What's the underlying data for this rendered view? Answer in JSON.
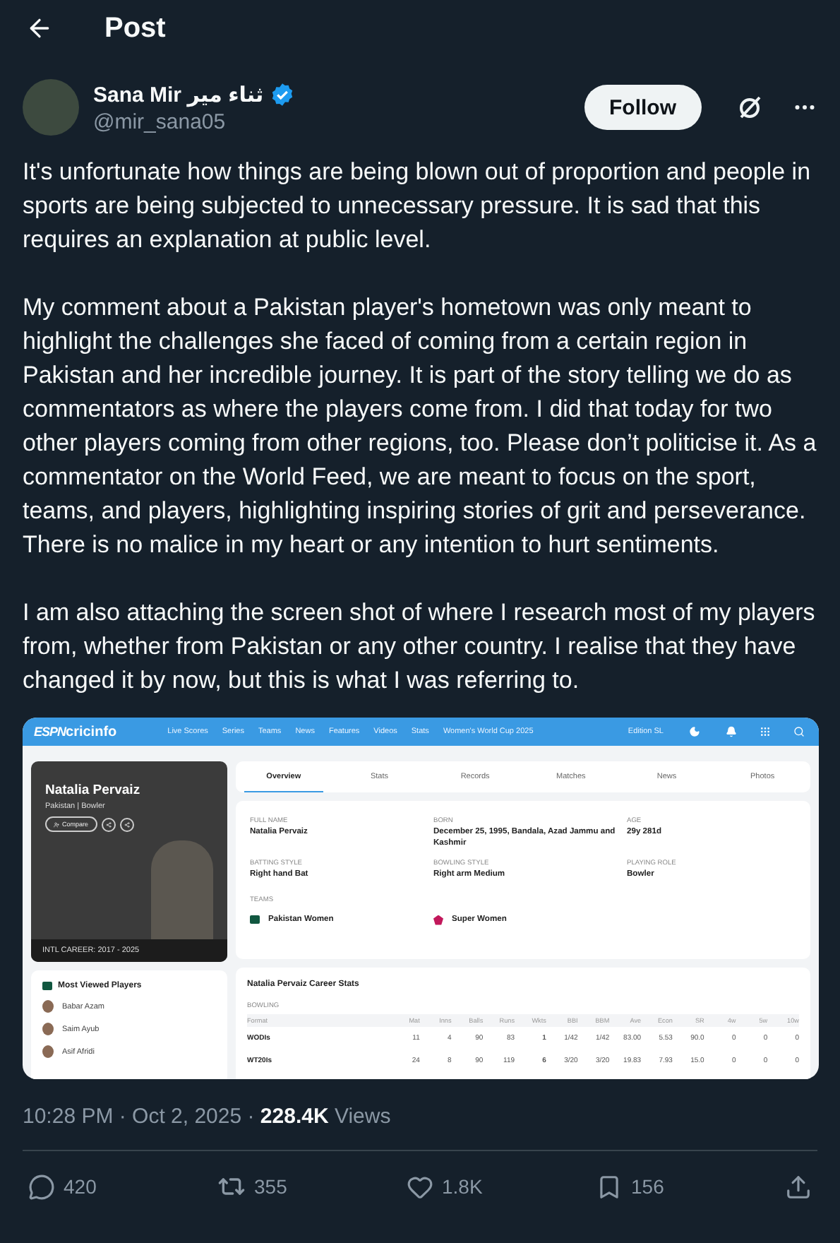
{
  "header": {
    "title": "Post"
  },
  "author": {
    "name": "Sana Mir ثناء میر",
    "handle": "@mir_sana05",
    "verified": true,
    "follow_label": "Follow"
  },
  "paragraphs": [
    "It's unfortunate how things are being blown out of proportion and people in sports are being subjected to unnecessary pressure. It is sad that this requires an explanation at public level.",
    "My comment about a Pakistan player's hometown was only meant to highlight the challenges she faced of coming from a certain region in Pakistan and her incredible journey. It is part of the story telling we do as commentators as where the players come from. I did that today for two other players coming from other regions, too. Please don’t politicise it. As a commentator on the World Feed, we are meant to focus on the sport, teams, and players, highlighting inspiring stories of grit and perseverance. There is no malice in my heart or any intention to hurt sentiments.",
    "I am also attaching the screen shot of where I research most of my players from, whether from Pakistan or any other country. I realise that they have changed it by now, but this is what I was referring to."
  ],
  "embed": {
    "nav": {
      "brand": "ESPN",
      "site": "cricinfo",
      "links": [
        "Live Scores",
        "Series",
        "Teams",
        "News",
        "Features",
        "Videos",
        "Stats",
        "Women's World Cup 2025"
      ],
      "edition": "Edition SL"
    },
    "profile": {
      "name": "Natalia Pervaiz",
      "subtitle": "Pakistan | Bowler",
      "compare_label": "Compare",
      "career": "INTL CAREER: 2017 - 2025"
    },
    "most_viewed": {
      "title": "Most Viewed Players",
      "players": [
        "Babar Azam",
        "Saim Ayub",
        "Asif Afridi"
      ]
    },
    "tabs": [
      {
        "label": "Overview",
        "selected": true
      },
      {
        "label": "Stats",
        "selected": false
      },
      {
        "label": "Records",
        "selected": false
      },
      {
        "label": "Matches",
        "selected": false
      },
      {
        "label": "News",
        "selected": false
      },
      {
        "label": "Photos",
        "selected": false
      }
    ],
    "fields": [
      {
        "label": "FULL NAME",
        "value": "Natalia Pervaiz"
      },
      {
        "label": "BORN",
        "value": "December 25, 1995, Bandala, Azad Jammu and Kashmir"
      },
      {
        "label": "AGE",
        "value": "29y 281d"
      },
      {
        "label": "BATTING STYLE",
        "value": "Right hand Bat"
      },
      {
        "label": "BOWLING STYLE",
        "value": "Right arm Medium"
      },
      {
        "label": "PLAYING ROLE",
        "value": "Bowler"
      }
    ],
    "teams": {
      "label": "TEAMS",
      "items": [
        {
          "kind": "flag",
          "name": "Pakistan Women"
        },
        {
          "kind": "club",
          "name": "Super Women"
        }
      ]
    },
    "stats": {
      "title": "Natalia Pervaiz Career Stats",
      "section": "BOWLING",
      "columns": [
        "Format",
        "Mat",
        "Inns",
        "Balls",
        "Runs",
        "Wkts",
        "BBI",
        "BBM",
        "Ave",
        "Econ",
        "SR",
        "4w",
        "5w",
        "10w"
      ],
      "rows": [
        [
          "WODIs",
          "11",
          "4",
          "90",
          "83",
          "1",
          "1/42",
          "1/42",
          "83.00",
          "5.53",
          "90.0",
          "0",
          "0",
          "0"
        ],
        [
          "WT20Is",
          "24",
          "8",
          "90",
          "119",
          "6",
          "3/20",
          "3/20",
          "19.83",
          "7.93",
          "15.0",
          "0",
          "0",
          "0"
        ]
      ]
    }
  },
  "meta": {
    "time": "10:28 PM · Oct 2, 2025 · ",
    "views_count": "228.4K",
    "views_label": "Views"
  },
  "actions": [
    {
      "kind": "reply",
      "count": "420"
    },
    {
      "kind": "repost",
      "count": "355"
    },
    {
      "kind": "like",
      "count": "1.8K"
    },
    {
      "kind": "bookmark",
      "count": "156"
    },
    {
      "kind": "share"
    }
  ]
}
